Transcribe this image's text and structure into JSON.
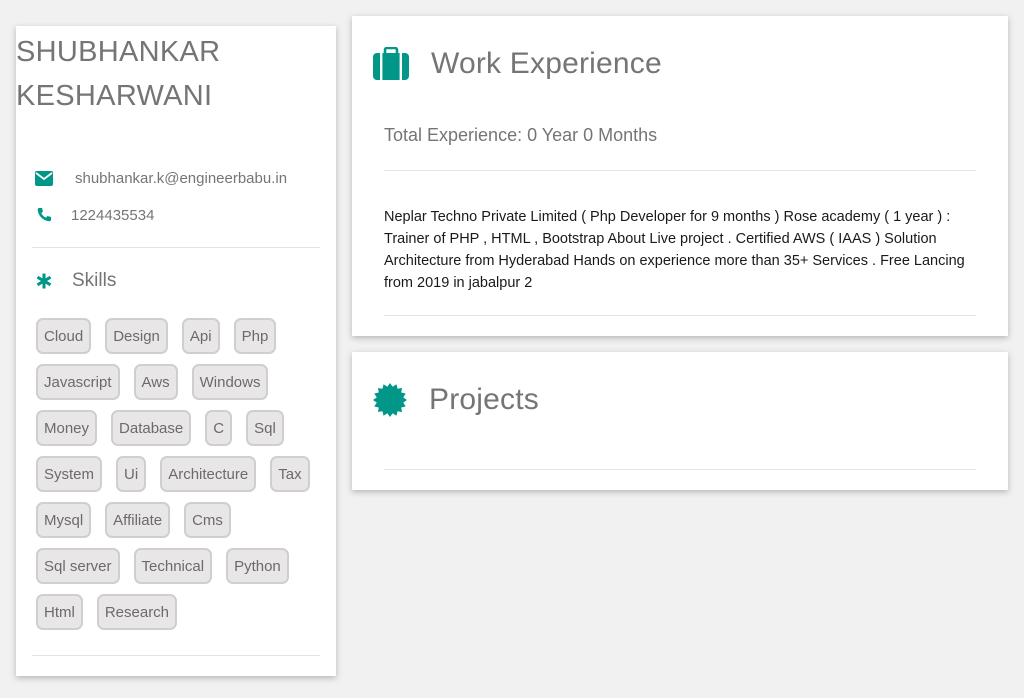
{
  "colors": {
    "accent": "#009688",
    "background": "#f1f1f1",
    "text": "#757575"
  },
  "profile": {
    "name_line1": "SHUBHANKAR",
    "name_line2": "KESHARWANI",
    "email": "shubhankar.k@engineerbabu.in",
    "email_icon": "envelope-icon",
    "phone": "1224435534",
    "phone_icon": "phone-icon"
  },
  "skills": {
    "title": "Skills",
    "icon": "asterisk-icon",
    "items": [
      "Cloud",
      "Design",
      "Api",
      "Php",
      "Javascript",
      "Aws",
      "Windows",
      "Money",
      "Database",
      "C",
      "Sql",
      "System",
      "Ui",
      "Architecture",
      "Tax",
      "Mysql",
      "Affiliate",
      "Cms",
      "Sql server",
      "Technical",
      "Python",
      "Html",
      "Research"
    ]
  },
  "work": {
    "title": "Work Experience",
    "icon": "briefcase-icon",
    "total_experience": "Total Experience: 0 Year 0 Months",
    "description": "Neplar Techno Private Limited ( Php Developer for 9 months ) Rose academy ( 1 year ) : Trainer of PHP , HTML , Bootstrap About Live project . Certified AWS ( IAAS ) Solution Architecture from Hyderabad Hands on experience more than 35+ Services . Free Lancing from 2019 in jabalpur 2"
  },
  "projects": {
    "title": "Projects",
    "icon": "certificate-icon"
  }
}
